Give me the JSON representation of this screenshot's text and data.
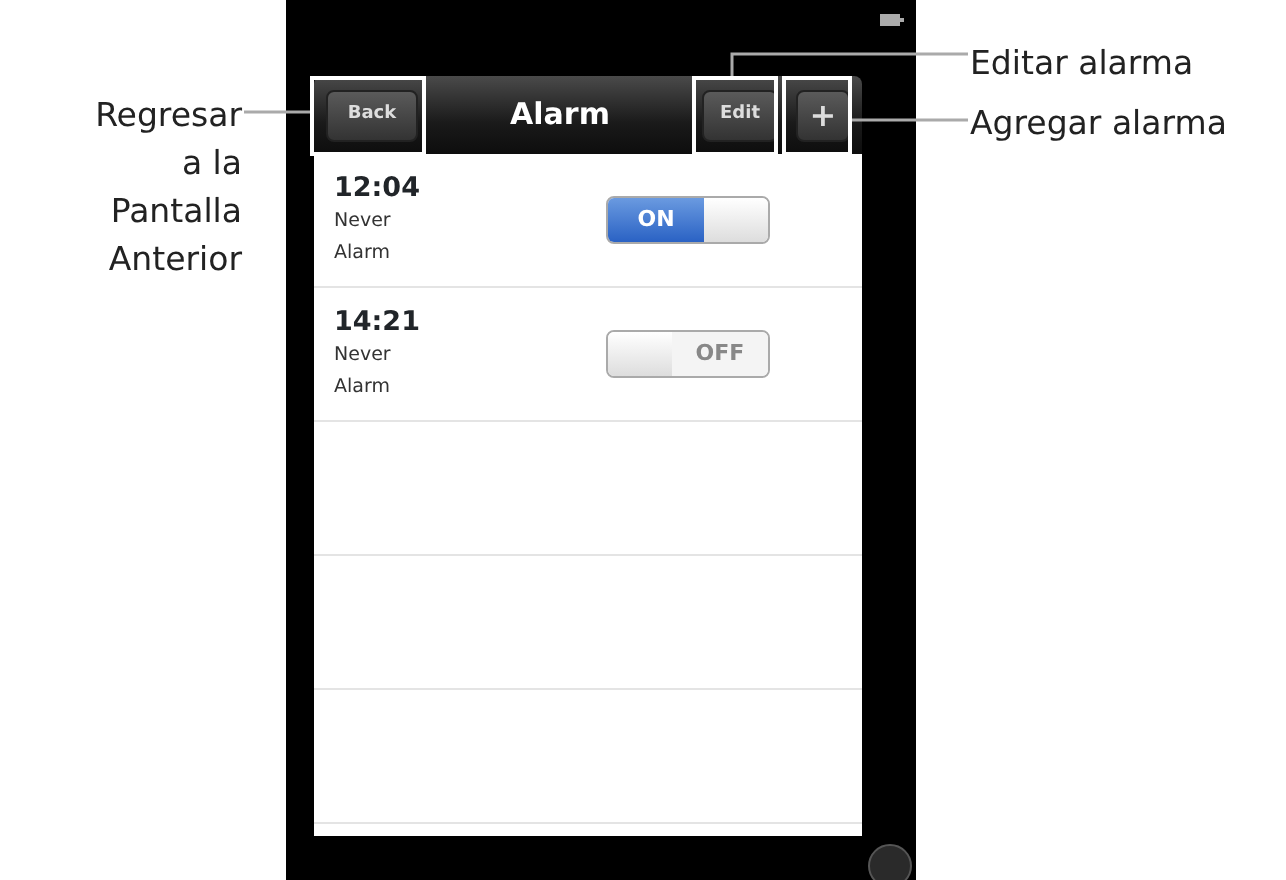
{
  "left_callouts": [
    {
      "text": "Regresar a la Pantalla Anterior"
    }
  ],
  "right_callouts": [
    {
      "text": "Editar alarma"
    },
    {
      "text": "Agregar alarma"
    }
  ],
  "nav": {
    "back": "Back",
    "title": "Alarm",
    "edit": "Edit",
    "add": "+"
  },
  "alarms": [
    {
      "time": "12:04",
      "repeat": "Never",
      "label": "Alarm",
      "on": true,
      "switch_text": "ON"
    },
    {
      "time": "14:21",
      "repeat": "Never",
      "label": "Alarm",
      "on": false,
      "switch_text": "OFF"
    }
  ]
}
